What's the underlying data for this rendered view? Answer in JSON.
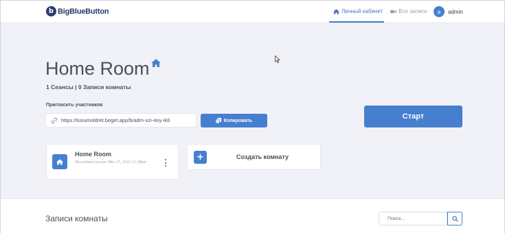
{
  "header": {
    "logo_mark": "b",
    "logo_text": "BigBlueButton",
    "nav": {
      "home_label": "Личный кабинет",
      "recordings_label": "Все записи"
    },
    "user": {
      "avatar_letter": "a",
      "name": "admin"
    }
  },
  "room": {
    "title": "Home Room",
    "stats": "1 Сеансы | 0 Записи комнаты",
    "invite_label": "Пригласить участников",
    "invite_link": "https://tusumoldret.beget.app/b/adm-xzi-4oy-ik6",
    "copy_label": "Копировать",
    "start_label": "Старт"
  },
  "room_card": {
    "title": "Home Room",
    "last_session": "Последняя сессия: Mar 27, 2022 12:28pm"
  },
  "create_card": {
    "plus": "+",
    "label": "Создать комнату"
  },
  "records": {
    "title": "Записи комнаты",
    "search_placeholder": "Поиск..."
  },
  "colors": {
    "accent": "#467fcf",
    "brand": "#283a6b",
    "background": "#f1f2f8"
  },
  "icons": {
    "home_nav": "home-icon",
    "recordings_nav": "video-icon",
    "link": "link-icon",
    "copy": "copy-icon",
    "search": "search-icon"
  }
}
